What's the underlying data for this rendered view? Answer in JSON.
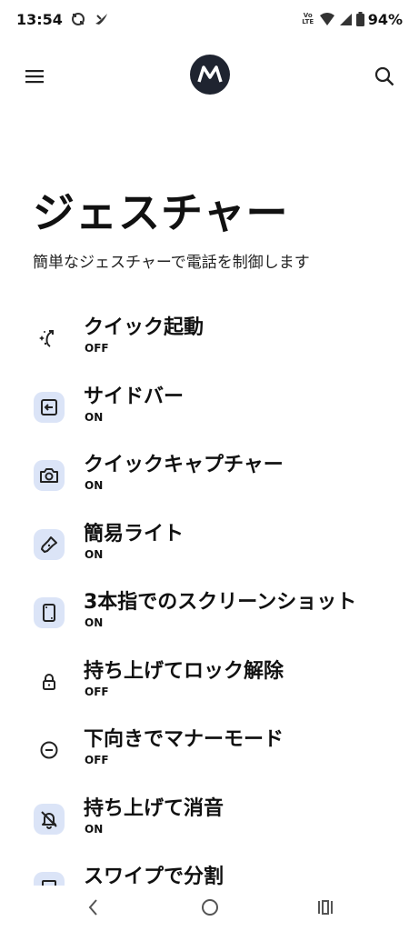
{
  "status_bar": {
    "time": "13:54",
    "volte": "Vo LTE",
    "battery": "94%"
  },
  "app_bar": {
    "menu_icon": "hamburger-menu-icon",
    "logo_icon": "motorola-logo",
    "search_icon": "search-icon"
  },
  "page": {
    "title": "ジェスチャー",
    "subtitle": "簡単なジェスチャーで電話を制御します"
  },
  "gestures": [
    {
      "title": "クイック起動",
      "status": "OFF",
      "icon": "sparkle-arrow-icon"
    },
    {
      "title": "サイドバー",
      "status": "ON",
      "icon": "sidebar-enter-icon"
    },
    {
      "title": "クイックキャプチャー",
      "status": "ON",
      "icon": "camera-icon"
    },
    {
      "title": "簡易ライト",
      "status": "ON",
      "icon": "flashlight-icon"
    },
    {
      "title": "3本指でのスクリーンショット",
      "status": "ON",
      "icon": "phone-screenshot-icon"
    },
    {
      "title": "持ち上げてロック解除",
      "status": "OFF",
      "icon": "lock-icon"
    },
    {
      "title": "下向きでマナーモード",
      "status": "OFF",
      "icon": "do-not-disturb-icon"
    },
    {
      "title": "持ち上げて消音",
      "status": "ON",
      "icon": "bell-off-icon"
    },
    {
      "title": "スワイプで分割",
      "status": "",
      "icon": "split-screen-icon"
    }
  ],
  "nav": {
    "back_icon": "back-chevron-icon",
    "home_icon": "home-circle-icon",
    "recents_icon": "recents-icon"
  }
}
